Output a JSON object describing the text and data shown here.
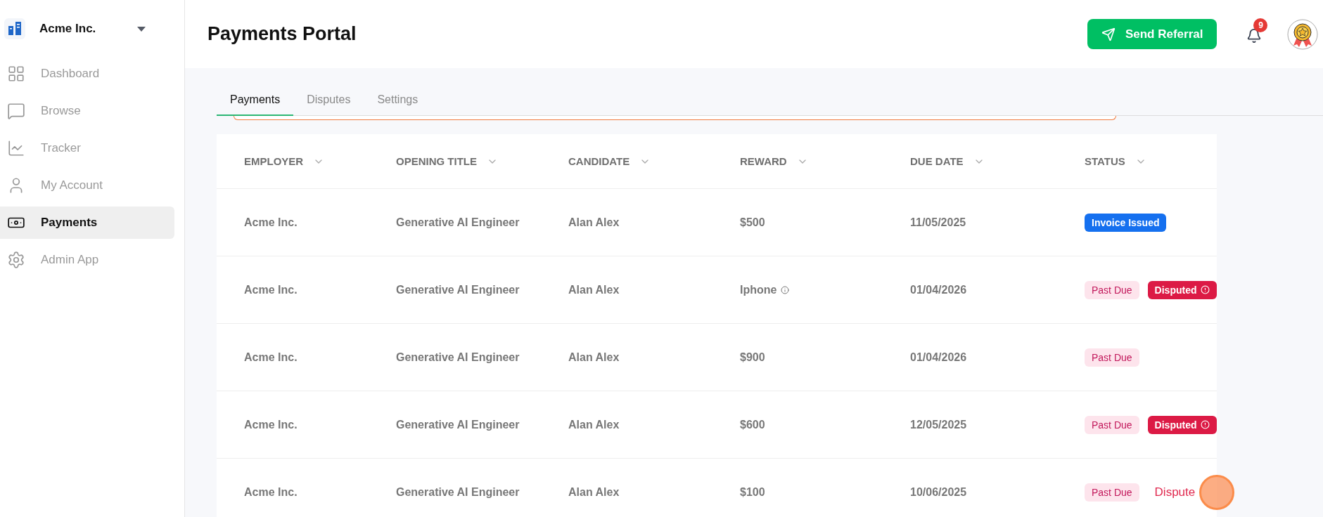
{
  "sidebar": {
    "org": {
      "name": "Acme Inc."
    },
    "items": [
      {
        "label": "Dashboard",
        "selected": false
      },
      {
        "label": "Browse",
        "selected": false
      },
      {
        "label": "Tracker",
        "selected": false
      },
      {
        "label": "My Account",
        "selected": false
      },
      {
        "label": "Payments",
        "selected": true
      },
      {
        "label": "Admin App",
        "selected": false
      }
    ]
  },
  "header": {
    "title": "Payments Portal",
    "button": "Send Referral",
    "notifications": "9"
  },
  "tabs": [
    {
      "label": "Payments",
      "selected": true
    },
    {
      "label": "Disputes",
      "selected": false
    },
    {
      "label": "Settings",
      "selected": false
    }
  ],
  "table": {
    "columns": [
      "EMPLOYER",
      "OPENING TITLE",
      "CANDIDATE",
      "REWARD",
      "DUE DATE",
      "STATUS"
    ],
    "rows": [
      {
        "employer": "Acme Inc.",
        "title": "Generative AI Engineer",
        "candidate": "Alan Alex",
        "reward": "$500",
        "info": false,
        "due": "11/05/2025",
        "status": [
          {
            "kind": "invoice",
            "label": "Invoice Issued"
          }
        ]
      },
      {
        "employer": "Acme Inc.",
        "title": "Generative AI Engineer",
        "candidate": "Alan Alex",
        "reward": "Iphone",
        "info": true,
        "due": "01/04/2026",
        "status": [
          {
            "kind": "pastdue",
            "label": "Past Due"
          },
          {
            "kind": "disputed",
            "label": "Disputed"
          }
        ]
      },
      {
        "employer": "Acme Inc.",
        "title": "Generative AI Engineer",
        "candidate": "Alan Alex",
        "reward": "$900",
        "info": false,
        "due": "01/04/2026",
        "status": [
          {
            "kind": "pastdue",
            "label": "Past Due"
          }
        ]
      },
      {
        "employer": "Acme Inc.",
        "title": "Generative AI Engineer",
        "candidate": "Alan Alex",
        "reward": "$600",
        "info": false,
        "due": "12/05/2025",
        "status": [
          {
            "kind": "pastdue",
            "label": "Past Due"
          },
          {
            "kind": "disputed",
            "label": "Disputed"
          }
        ]
      },
      {
        "employer": "Acme Inc.",
        "title": "Generative AI Engineer",
        "candidate": "Alan Alex",
        "reward": "$100",
        "info": false,
        "due": "10/06/2025",
        "status": [
          {
            "kind": "pastdue",
            "label": "Past Due"
          },
          {
            "kind": "link",
            "label": "Dispute"
          }
        ]
      }
    ]
  }
}
